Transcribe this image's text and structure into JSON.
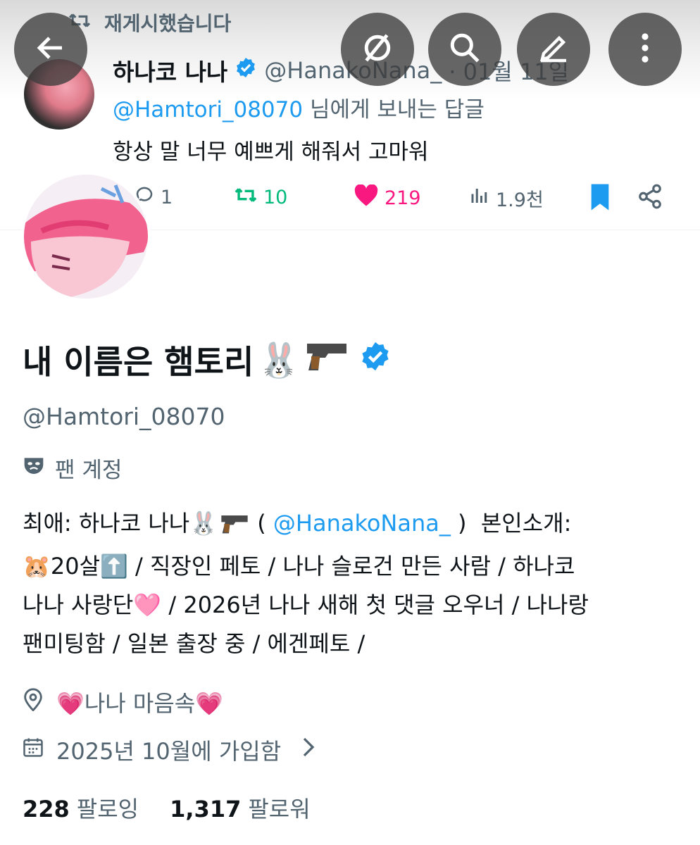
{
  "tweet": {
    "retweet_label": "재게시했습니다",
    "author_name": "하나코 나나",
    "author_handle": "@HanakoNana_",
    "date": "· 01월 11일",
    "reply_to_handle": "@Hamtori_08070",
    "reply_to_suffix": "님에게 보내는 답글",
    "text": "항상 말 너무 예쁘게 해줘서 고마워",
    "replies": "1",
    "retweets": "10",
    "likes": "219",
    "views": "1.9천"
  },
  "profile": {
    "name": "내 이름은 햄토리",
    "name_emoji": "🐰",
    "handle": "@Hamtori_08070",
    "account_label": "팬 계정",
    "bio_line1_prefix": "최애: 하나코 나나🐰",
    "bio_line1_mention_open": " ( ",
    "bio_line1_mention": "@HanakoNana_",
    "bio_line1_suffix": " )  본인소개:",
    "bio_line2": "🐹20살⬆️ / 직장인 페토 / 나나 슬로건 만든 사람 / 하나코",
    "bio_line3": "나나 사랑단🩷 / 2026년 나나 새해 첫 댓글 오우너 / 나나랑",
    "bio_line4": "팬미팅함 / 일본 출장 중 / 에겐페토 /",
    "location": "💗나나 마음속💗",
    "joined": "2025년 10월에 가입함",
    "following_count": "228",
    "following_label": "팔로잉",
    "followers_count": "1,317",
    "followers_label": "팔로워"
  },
  "colors": {
    "accent": "#1d9bf0",
    "retweet_green": "#00ba7c",
    "like_pink": "#f91880",
    "muted": "#536471"
  },
  "icons": [
    "back-arrow-icon",
    "hide-icon",
    "search-icon",
    "edit-icon",
    "more-vertical-icon",
    "retweet-icon",
    "verified-badge-icon",
    "reply-icon",
    "like-icon",
    "views-icon",
    "bookmark-icon",
    "share-icon",
    "mask-icon",
    "location-icon",
    "calendar-icon",
    "chevron-right-icon",
    "gun-emoji-icon"
  ]
}
